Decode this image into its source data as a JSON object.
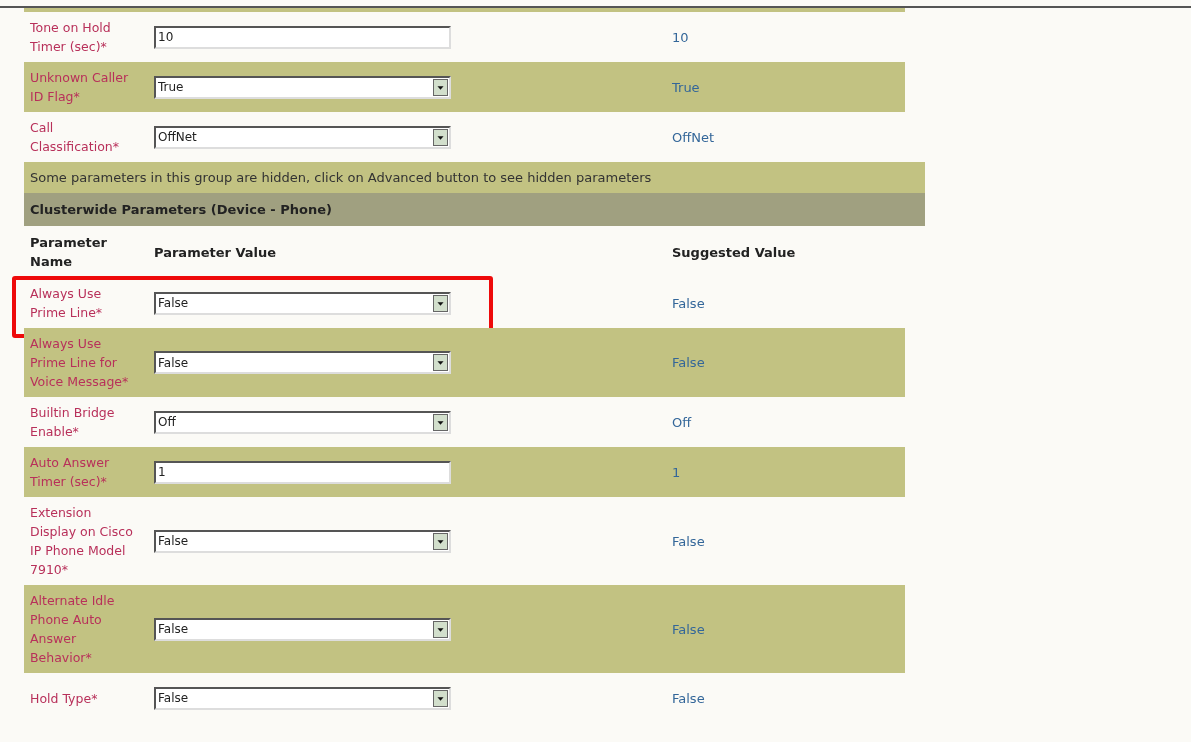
{
  "group_1": {
    "rows": [
      {
        "name": "Tone on Hold Timer (sec)*",
        "kind": "input",
        "value": "10",
        "suggested": "10",
        "highlighted": false
      },
      {
        "name": "Unknown Caller ID Flag*",
        "kind": "select",
        "value": "True",
        "suggested": "True",
        "highlighted": false
      },
      {
        "name": "Call Classification*",
        "kind": "select",
        "value": "OffNet",
        "suggested": "OffNet",
        "highlighted": false
      }
    ],
    "notice": "Some parameters in this group are hidden, click on Advanced button to see hidden parameters"
  },
  "group_2": {
    "title": "Clusterwide Parameters (Device - Phone)",
    "columns": [
      "Parameter Name",
      "Parameter Value",
      "Suggested Value"
    ],
    "rows": [
      {
        "name": "Always Use Prime Line*",
        "kind": "select",
        "value": "False",
        "suggested": "False",
        "highlighted": true
      },
      {
        "name": "Always Use Prime Line for Voice Message*",
        "kind": "select",
        "value": "False",
        "suggested": "False",
        "highlighted": false
      },
      {
        "name": "Builtin Bridge Enable*",
        "kind": "select",
        "value": "Off",
        "suggested": "Off",
        "highlighted": false
      },
      {
        "name": "Auto Answer Timer (sec)*",
        "kind": "input",
        "value": "1",
        "suggested": "1",
        "highlighted": false
      },
      {
        "name": "Extension Display on Cisco IP Phone Model 7910*",
        "kind": "select",
        "value": "False",
        "suggested": "False",
        "highlighted": false
      },
      {
        "name": "Alternate Idle Phone Auto Answer Behavior*",
        "kind": "select",
        "value": "False",
        "suggested": "False",
        "highlighted": false
      },
      {
        "name": "Hold Type*",
        "kind": "select",
        "value": "False",
        "suggested": "False",
        "highlighted": false
      }
    ]
  }
}
